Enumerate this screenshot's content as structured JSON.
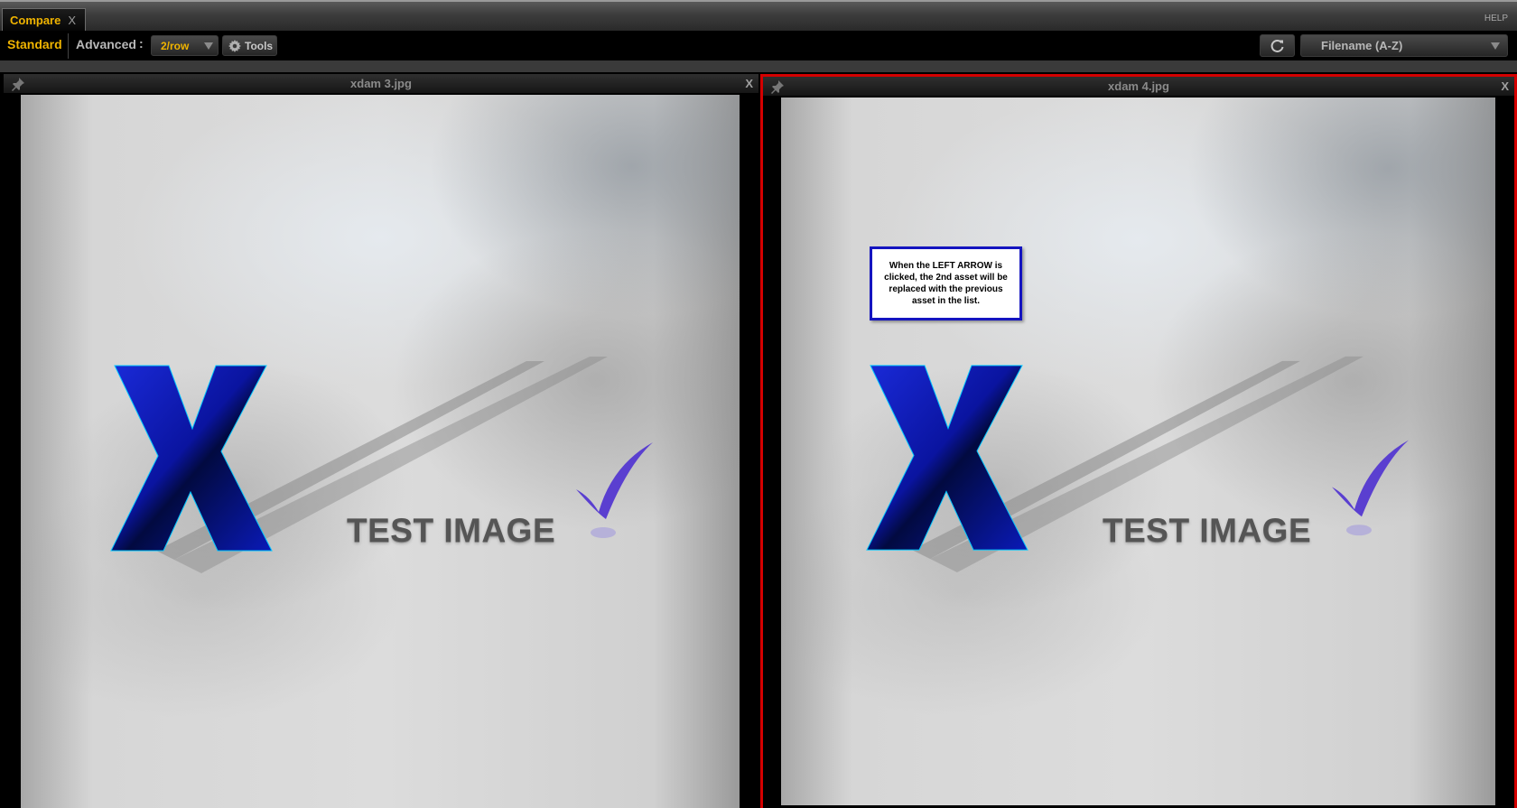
{
  "titlebar": {
    "tab_label": "Compare",
    "tab_close": "X",
    "help": "HELP"
  },
  "toolbar": {
    "standard": "Standard",
    "advanced": "Advanced",
    "advanced_dots": ":",
    "per_row": "2/row",
    "tools": "Tools",
    "sort": "Filename (A-Z)"
  },
  "panels": [
    {
      "title": "xdam 3.jpg",
      "close": "X",
      "image_text": "TEST IMAGE",
      "image_letter": "X",
      "selected": false
    },
    {
      "title": "xdam 4.jpg",
      "close": "X",
      "image_text": "TEST IMAGE",
      "image_letter": "X",
      "selected": true
    }
  ],
  "callout": {
    "text": "When the LEFT ARROW is clicked, the 2nd asset will be replaced with the previous asset in the list."
  },
  "colors": {
    "accent": "#f0b400",
    "selection_border": "#d40000",
    "callout_border": "#1414c0",
    "logo_blue": "#0a1ab8",
    "check_purple": "#5a3fd0"
  },
  "icons": {
    "pin": "pin-icon",
    "gear": "gear-icon",
    "refresh": "refresh-icon",
    "caret": "chevron-down-icon"
  }
}
